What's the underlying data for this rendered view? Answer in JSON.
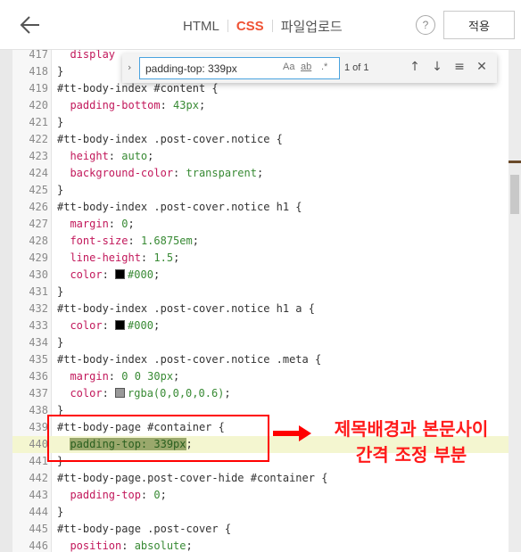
{
  "header": {
    "tabs": [
      {
        "label": "HTML",
        "active": false
      },
      {
        "label": "CSS",
        "active": true
      },
      {
        "label": "파일업로드",
        "active": false
      }
    ],
    "help_label": "?",
    "apply_label": "적용"
  },
  "find": {
    "query": "padding-top: 339px",
    "match_case": "Aa",
    "whole_word": "ab",
    "regex": ".*",
    "result": "1 of 1",
    "icons": [
      "arrow-up-icon",
      "arrow-down-icon",
      "find-in-selection-icon",
      "close-icon"
    ]
  },
  "code_lines": [
    {
      "n": "417",
      "parts": [
        [
          "prop",
          "  display"
        ]
      ]
    },
    {
      "n": "418",
      "parts": [
        [
          "sel",
          "}"
        ]
      ]
    },
    {
      "n": "419",
      "parts": [
        [
          "sel",
          "#tt-body-index #content {"
        ]
      ]
    },
    {
      "n": "420",
      "parts": [
        [
          "prop",
          "  padding-bottom"
        ],
        [
          "sel",
          ": "
        ],
        [
          "num",
          "43px"
        ],
        [
          "sel",
          ";"
        ]
      ]
    },
    {
      "n": "421",
      "parts": [
        [
          "sel",
          "}"
        ]
      ]
    },
    {
      "n": "422",
      "parts": [
        [
          "sel",
          "#tt-body-index .post-cover.notice {"
        ]
      ]
    },
    {
      "n": "423",
      "parts": [
        [
          "prop",
          "  height"
        ],
        [
          "sel",
          ": "
        ],
        [
          "val",
          "auto"
        ],
        [
          "sel",
          ";"
        ]
      ]
    },
    {
      "n": "424",
      "parts": [
        [
          "prop",
          "  background-color"
        ],
        [
          "sel",
          ": "
        ],
        [
          "val",
          "transparent"
        ],
        [
          "sel",
          ";"
        ]
      ]
    },
    {
      "n": "425",
      "parts": [
        [
          "sel",
          "}"
        ]
      ]
    },
    {
      "n": "426",
      "parts": [
        [
          "sel",
          "#tt-body-index .post-cover.notice h1 {"
        ]
      ]
    },
    {
      "n": "427",
      "parts": [
        [
          "prop",
          "  margin"
        ],
        [
          "sel",
          ": "
        ],
        [
          "num",
          "0"
        ],
        [
          "sel",
          ";"
        ]
      ]
    },
    {
      "n": "428",
      "parts": [
        [
          "prop",
          "  font-size"
        ],
        [
          "sel",
          ": "
        ],
        [
          "num",
          "1.6875em"
        ],
        [
          "sel",
          ";"
        ]
      ]
    },
    {
      "n": "429",
      "parts": [
        [
          "prop",
          "  line-height"
        ],
        [
          "sel",
          ": "
        ],
        [
          "num",
          "1.5"
        ],
        [
          "sel",
          ";"
        ]
      ]
    },
    {
      "n": "430",
      "parts": [
        [
          "prop",
          "  color"
        ],
        [
          "sel",
          ": "
        ],
        [
          "swatch",
          "#000000"
        ],
        [
          "val",
          "#000"
        ],
        [
          "sel",
          ";"
        ]
      ]
    },
    {
      "n": "431",
      "parts": [
        [
          "sel",
          "}"
        ]
      ]
    },
    {
      "n": "432",
      "parts": [
        [
          "sel",
          "#tt-body-index .post-cover.notice h1 a {"
        ]
      ]
    },
    {
      "n": "433",
      "parts": [
        [
          "prop",
          "  color"
        ],
        [
          "sel",
          ": "
        ],
        [
          "swatch",
          "#000000"
        ],
        [
          "val",
          "#000"
        ],
        [
          "sel",
          ";"
        ]
      ]
    },
    {
      "n": "434",
      "parts": [
        [
          "sel",
          "}"
        ]
      ]
    },
    {
      "n": "435",
      "parts": [
        [
          "sel",
          "#tt-body-index .post-cover.notice .meta {"
        ]
      ]
    },
    {
      "n": "436",
      "parts": [
        [
          "prop",
          "  margin"
        ],
        [
          "sel",
          ": "
        ],
        [
          "num",
          "0 0 30px"
        ],
        [
          "sel",
          ";"
        ]
      ]
    },
    {
      "n": "437",
      "parts": [
        [
          "prop",
          "  color"
        ],
        [
          "sel",
          ": "
        ],
        [
          "swatch",
          "#999999"
        ],
        [
          "val",
          "rgba(0,0,0,0.6)"
        ],
        [
          "sel",
          ";"
        ]
      ]
    },
    {
      "n": "438",
      "parts": [
        [
          "sel",
          "}"
        ]
      ]
    },
    {
      "n": "439",
      "parts": [
        [
          "sel",
          "#tt-body-page #container {"
        ]
      ]
    },
    {
      "n": "440",
      "highlight": true,
      "parts": [
        [
          "sel",
          "  "
        ],
        [
          "match",
          "padding-top: 339px"
        ],
        [
          "sel",
          ";"
        ]
      ]
    },
    {
      "n": "441",
      "parts": [
        [
          "sel",
          "}"
        ]
      ]
    },
    {
      "n": "442",
      "parts": [
        [
          "sel",
          "#tt-body-page.post-cover-hide #container {"
        ]
      ]
    },
    {
      "n": "443",
      "parts": [
        [
          "prop",
          "  padding-top"
        ],
        [
          "sel",
          ": "
        ],
        [
          "num",
          "0"
        ],
        [
          "sel",
          ";"
        ]
      ]
    },
    {
      "n": "444",
      "parts": [
        [
          "sel",
          "}"
        ]
      ]
    },
    {
      "n": "445",
      "parts": [
        [
          "sel",
          "#tt-body-page .post-cover {"
        ]
      ]
    },
    {
      "n": "446",
      "parts": [
        [
          "prop",
          "  position"
        ],
        [
          "sel",
          ": "
        ],
        [
          "val",
          "absolute"
        ],
        [
          "sel",
          ";"
        ]
      ]
    }
  ],
  "annotation": {
    "line1": "제목배경과 본문사이",
    "line2": "간격 조정 부분",
    "color": "#ff0000"
  },
  "colors": {
    "accent": "#ef5234",
    "property": "#c2185b",
    "value": "#388a34",
    "match_highlight": "#9aa86c"
  }
}
